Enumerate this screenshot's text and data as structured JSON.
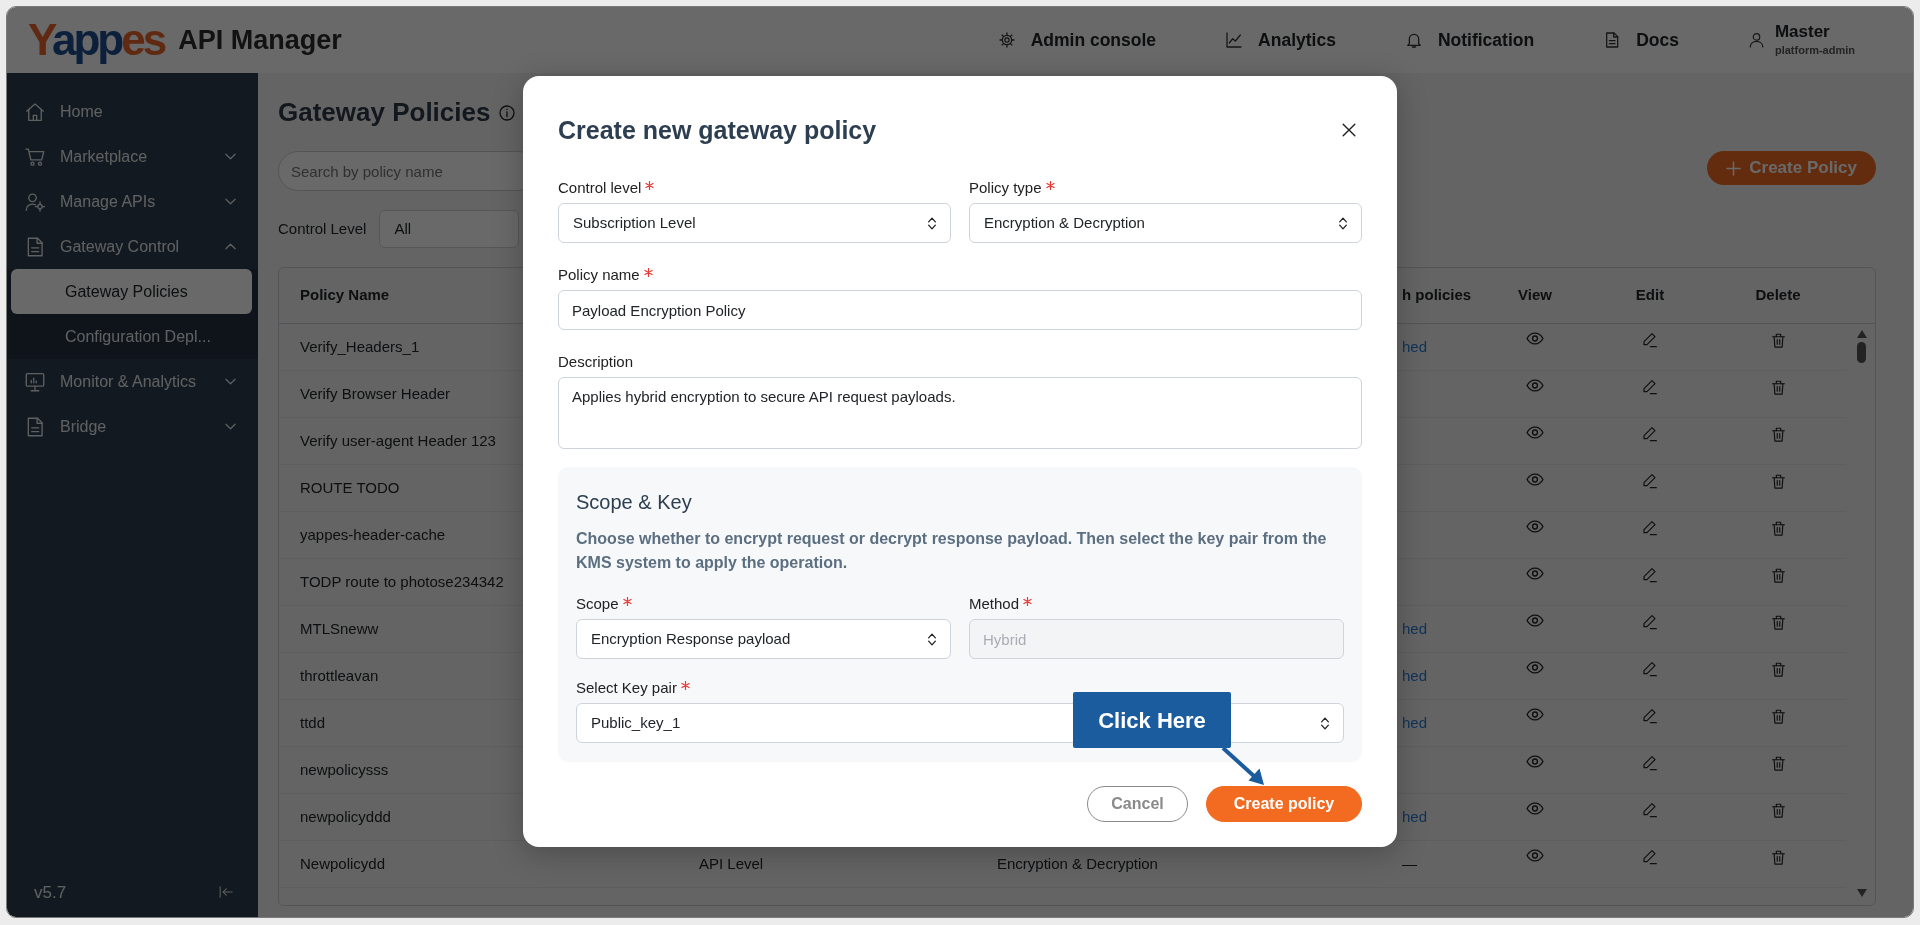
{
  "header": {
    "logo": "Yappes",
    "app_name": "API Manager",
    "nav": [
      {
        "label": "Admin console"
      },
      {
        "label": "Analytics"
      },
      {
        "label": "Notification"
      },
      {
        "label": "Docs"
      }
    ],
    "user": {
      "name": "Master",
      "role": "platform-admin"
    }
  },
  "sidebar": {
    "items": [
      {
        "label": "Home",
        "selected": false
      },
      {
        "label": "Marketplace",
        "selected": false,
        "expanded": false
      },
      {
        "label": "Manage APIs",
        "selected": false,
        "expanded": false
      },
      {
        "label": "Gateway Control",
        "selected": false,
        "expanded": true,
        "children": [
          {
            "label": "Gateway Policies",
            "selected": true
          },
          {
            "label": "Configuration Depl...",
            "selected": false
          }
        ]
      },
      {
        "label": "Monitor & Analytics",
        "selected": false,
        "expanded": false
      },
      {
        "label": "Bridge",
        "selected": false,
        "expanded": false
      }
    ],
    "version": "v5.7"
  },
  "page": {
    "title": "Gateway Policies",
    "search": {
      "placeholder": "Search by policy name"
    },
    "create_button": "Create Policy",
    "filter": {
      "label": "Control Level",
      "value": "All"
    },
    "table": {
      "columns": [
        {
          "label": "Policy Name"
        },
        {
          "label": "h policies"
        },
        {
          "label": "View"
        },
        {
          "label": "Edit"
        },
        {
          "label": "Delete"
        }
      ],
      "rows": [
        {
          "name": "Verify_Headers_1",
          "column_4": {
            "text": "hed",
            "kind": "link"
          }
        },
        {
          "name": "Verify Browser Header"
        },
        {
          "name": "Verify user-agent Header 123"
        },
        {
          "name": "ROUTE TODO"
        },
        {
          "name": "yappes-header-cache"
        },
        {
          "name": "TODP route to photose234342"
        },
        {
          "name": "MTLSneww",
          "column_4": {
            "text": "hed",
            "kind": "link"
          }
        },
        {
          "name": "throttleavan",
          "column_4": {
            "text": "hed",
            "kind": "link"
          }
        },
        {
          "name": "ttdd",
          "column_4": {
            "text": "hed",
            "kind": "link"
          }
        },
        {
          "name": "newpolicysss"
        },
        {
          "name": "newpolicyddd",
          "column_4": {
            "text": "hed",
            "kind": "link"
          }
        },
        {
          "name": "Newpolicydd",
          "column_2": "API Level",
          "column_3": "Encryption & Decryption",
          "column_4": {
            "text": "—",
            "kind": "text"
          }
        }
      ]
    }
  },
  "modal": {
    "title": "Create new gateway policy",
    "rows": [
      [
        {
          "kind": "select",
          "label": "Control level",
          "required": true,
          "disabled": false,
          "value": "Subscription Level"
        },
        {
          "kind": "select",
          "label": "Policy type",
          "required": true,
          "disabled": false,
          "value": "Encryption & Decryption"
        }
      ],
      [
        {
          "kind": "text",
          "label": "Policy name",
          "required": true,
          "disabled": false,
          "value": "Payload Encryption Policy"
        }
      ],
      [
        {
          "kind": "textarea",
          "label": "Description",
          "disabled": false,
          "value": "Applies hybrid encryption to secure API request payloads."
        }
      ]
    ],
    "section": {
      "title": "Scope & Key",
      "description": "Choose whether to encrypt request or decrypt response payload. Then select the key pair from the KMS system to apply the operation.",
      "rows": [
        [
          {
            "kind": "select",
            "label": "Scope",
            "required": true,
            "disabled": false,
            "value": "Encryption Response payload"
          },
          {
            "kind": "text",
            "label": "Method",
            "required": true,
            "disabled": true,
            "value": "Hybrid"
          }
        ],
        [
          {
            "kind": "select",
            "label": "Select Key pair",
            "required": true,
            "disabled": false,
            "value": "Public_key_1"
          }
        ]
      ]
    },
    "buttons": [
      {
        "label": "Cancel",
        "kind": "secondary"
      },
      {
        "label": "Create policy",
        "kind": "primary"
      }
    ]
  },
  "callout": {
    "text": "Click Here"
  }
}
